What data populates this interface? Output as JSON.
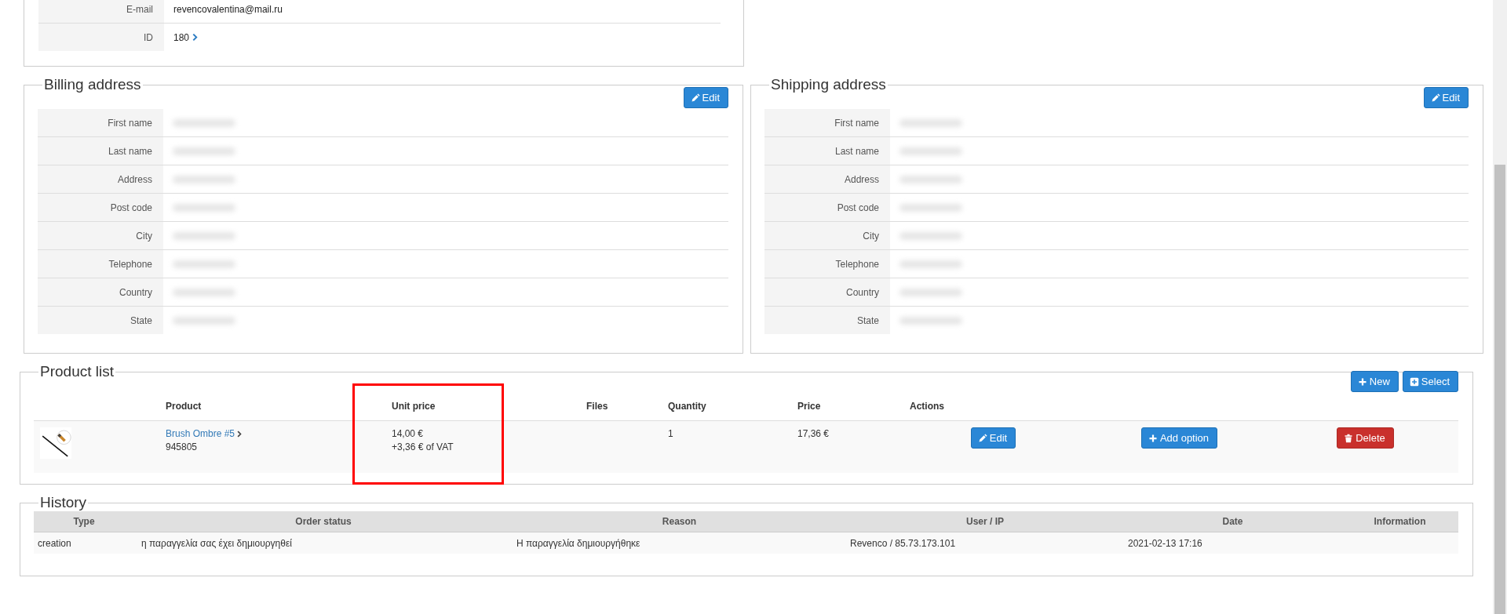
{
  "customer": {
    "rows": [
      {
        "label": "E-mail",
        "value": "revencovalentina@mail.ru",
        "link": false
      },
      {
        "label": "ID",
        "value": "180",
        "link": true
      }
    ]
  },
  "billing_address": {
    "title": "Billing address",
    "edit_button": "Edit",
    "rows": [
      {
        "label": "First name",
        "value_blurred": true
      },
      {
        "label": "Last name",
        "value_blurred": true
      },
      {
        "label": "Address",
        "value_blurred": true
      },
      {
        "label": "Post code",
        "value_blurred": true
      },
      {
        "label": "City",
        "value_blurred": true
      },
      {
        "label": "Telephone",
        "value_blurred": true
      },
      {
        "label": "Country",
        "value_blurred": true
      },
      {
        "label": "State",
        "value_blurred": true
      }
    ]
  },
  "shipping_address": {
    "title": "Shipping address",
    "edit_button": "Edit",
    "rows": [
      {
        "label": "First name",
        "value_blurred": true
      },
      {
        "label": "Last name",
        "value_blurred": true
      },
      {
        "label": "Address",
        "value_blurred": true
      },
      {
        "label": "Post code",
        "value_blurred": true
      },
      {
        "label": "City",
        "value_blurred": true
      },
      {
        "label": "Telephone",
        "value_blurred": true
      },
      {
        "label": "Country",
        "value_blurred": true
      },
      {
        "label": "State",
        "value_blurred": true
      }
    ]
  },
  "product_list": {
    "title": "Product list",
    "buttons": [
      {
        "label": "New",
        "kind": "new"
      },
      {
        "label": "Select",
        "kind": "select"
      }
    ],
    "columns": [
      {
        "label": "Product",
        "highlighted": false
      },
      {
        "label": "Unit price",
        "highlighted": true
      },
      {
        "label": "Files",
        "highlighted": false
      },
      {
        "label": "Quantity",
        "highlighted": false
      },
      {
        "label": "Price",
        "highlighted": false
      },
      {
        "label": "Actions",
        "highlighted": false
      }
    ],
    "rows": [
      {
        "product": "Brush Ombre #5",
        "sku": "945805",
        "unit_price": "14,00 €",
        "vat": "+3,36 € of VAT",
        "quantity": "1",
        "price": "17,36 €",
        "actions": [
          {
            "label": "Edit",
            "kind": "edit"
          },
          {
            "label": "Add option",
            "kind": "add"
          },
          {
            "label": "Delete",
            "kind": "delete"
          }
        ]
      }
    ]
  },
  "history": {
    "title": "History",
    "columns": [
      "Type",
      "Order status",
      "Reason",
      "User / IP",
      "Date",
      "Information"
    ],
    "rows": [
      {
        "cells": [
          "creation",
          "η παραγγελία σας έχει δημιουργηθεί",
          "Η παραγγελία δημιουργήθηκε",
          "Revenco / 85.73.173.101",
          "2021-02-13 17:16"
        ]
      }
    ]
  }
}
